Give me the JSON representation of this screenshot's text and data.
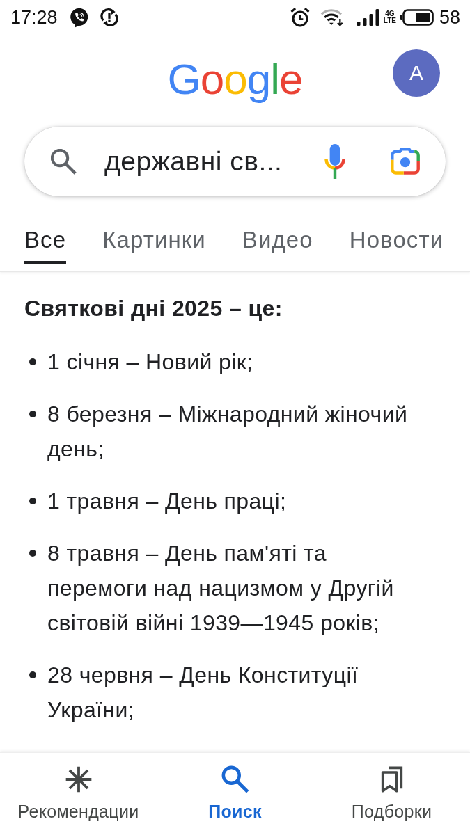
{
  "status_bar": {
    "time": "17:28",
    "network": "4G LTE",
    "battery": "58"
  },
  "header": {
    "logo": "Google",
    "avatar": "A"
  },
  "search": {
    "value": "державні св..."
  },
  "tabs": [
    {
      "label": "Все",
      "selected": true
    },
    {
      "label": "Картинки",
      "selected": false
    },
    {
      "label": "Видео",
      "selected": false
    },
    {
      "label": "Новости",
      "selected": false
    }
  ],
  "answer": {
    "heading": "Святкові дні 2025 – це:",
    "items": [
      "1 січня – Новий рік;",
      "8 березня – Міжнародний жіночий день;",
      "1 травня – День праці;",
      "8 травня – День пам'яті та перемоги над нацизмом у Другій світовій війні 1939—1945 років;",
      "28 червня – День Конституції України;"
    ]
  },
  "bottom_nav": [
    {
      "label": "Рекомендации",
      "kind": "asterisk",
      "selected": false
    },
    {
      "label": "Поиск",
      "kind": "search",
      "selected": true
    },
    {
      "label": "Подборки",
      "kind": "bookmarks",
      "selected": false
    }
  ]
}
